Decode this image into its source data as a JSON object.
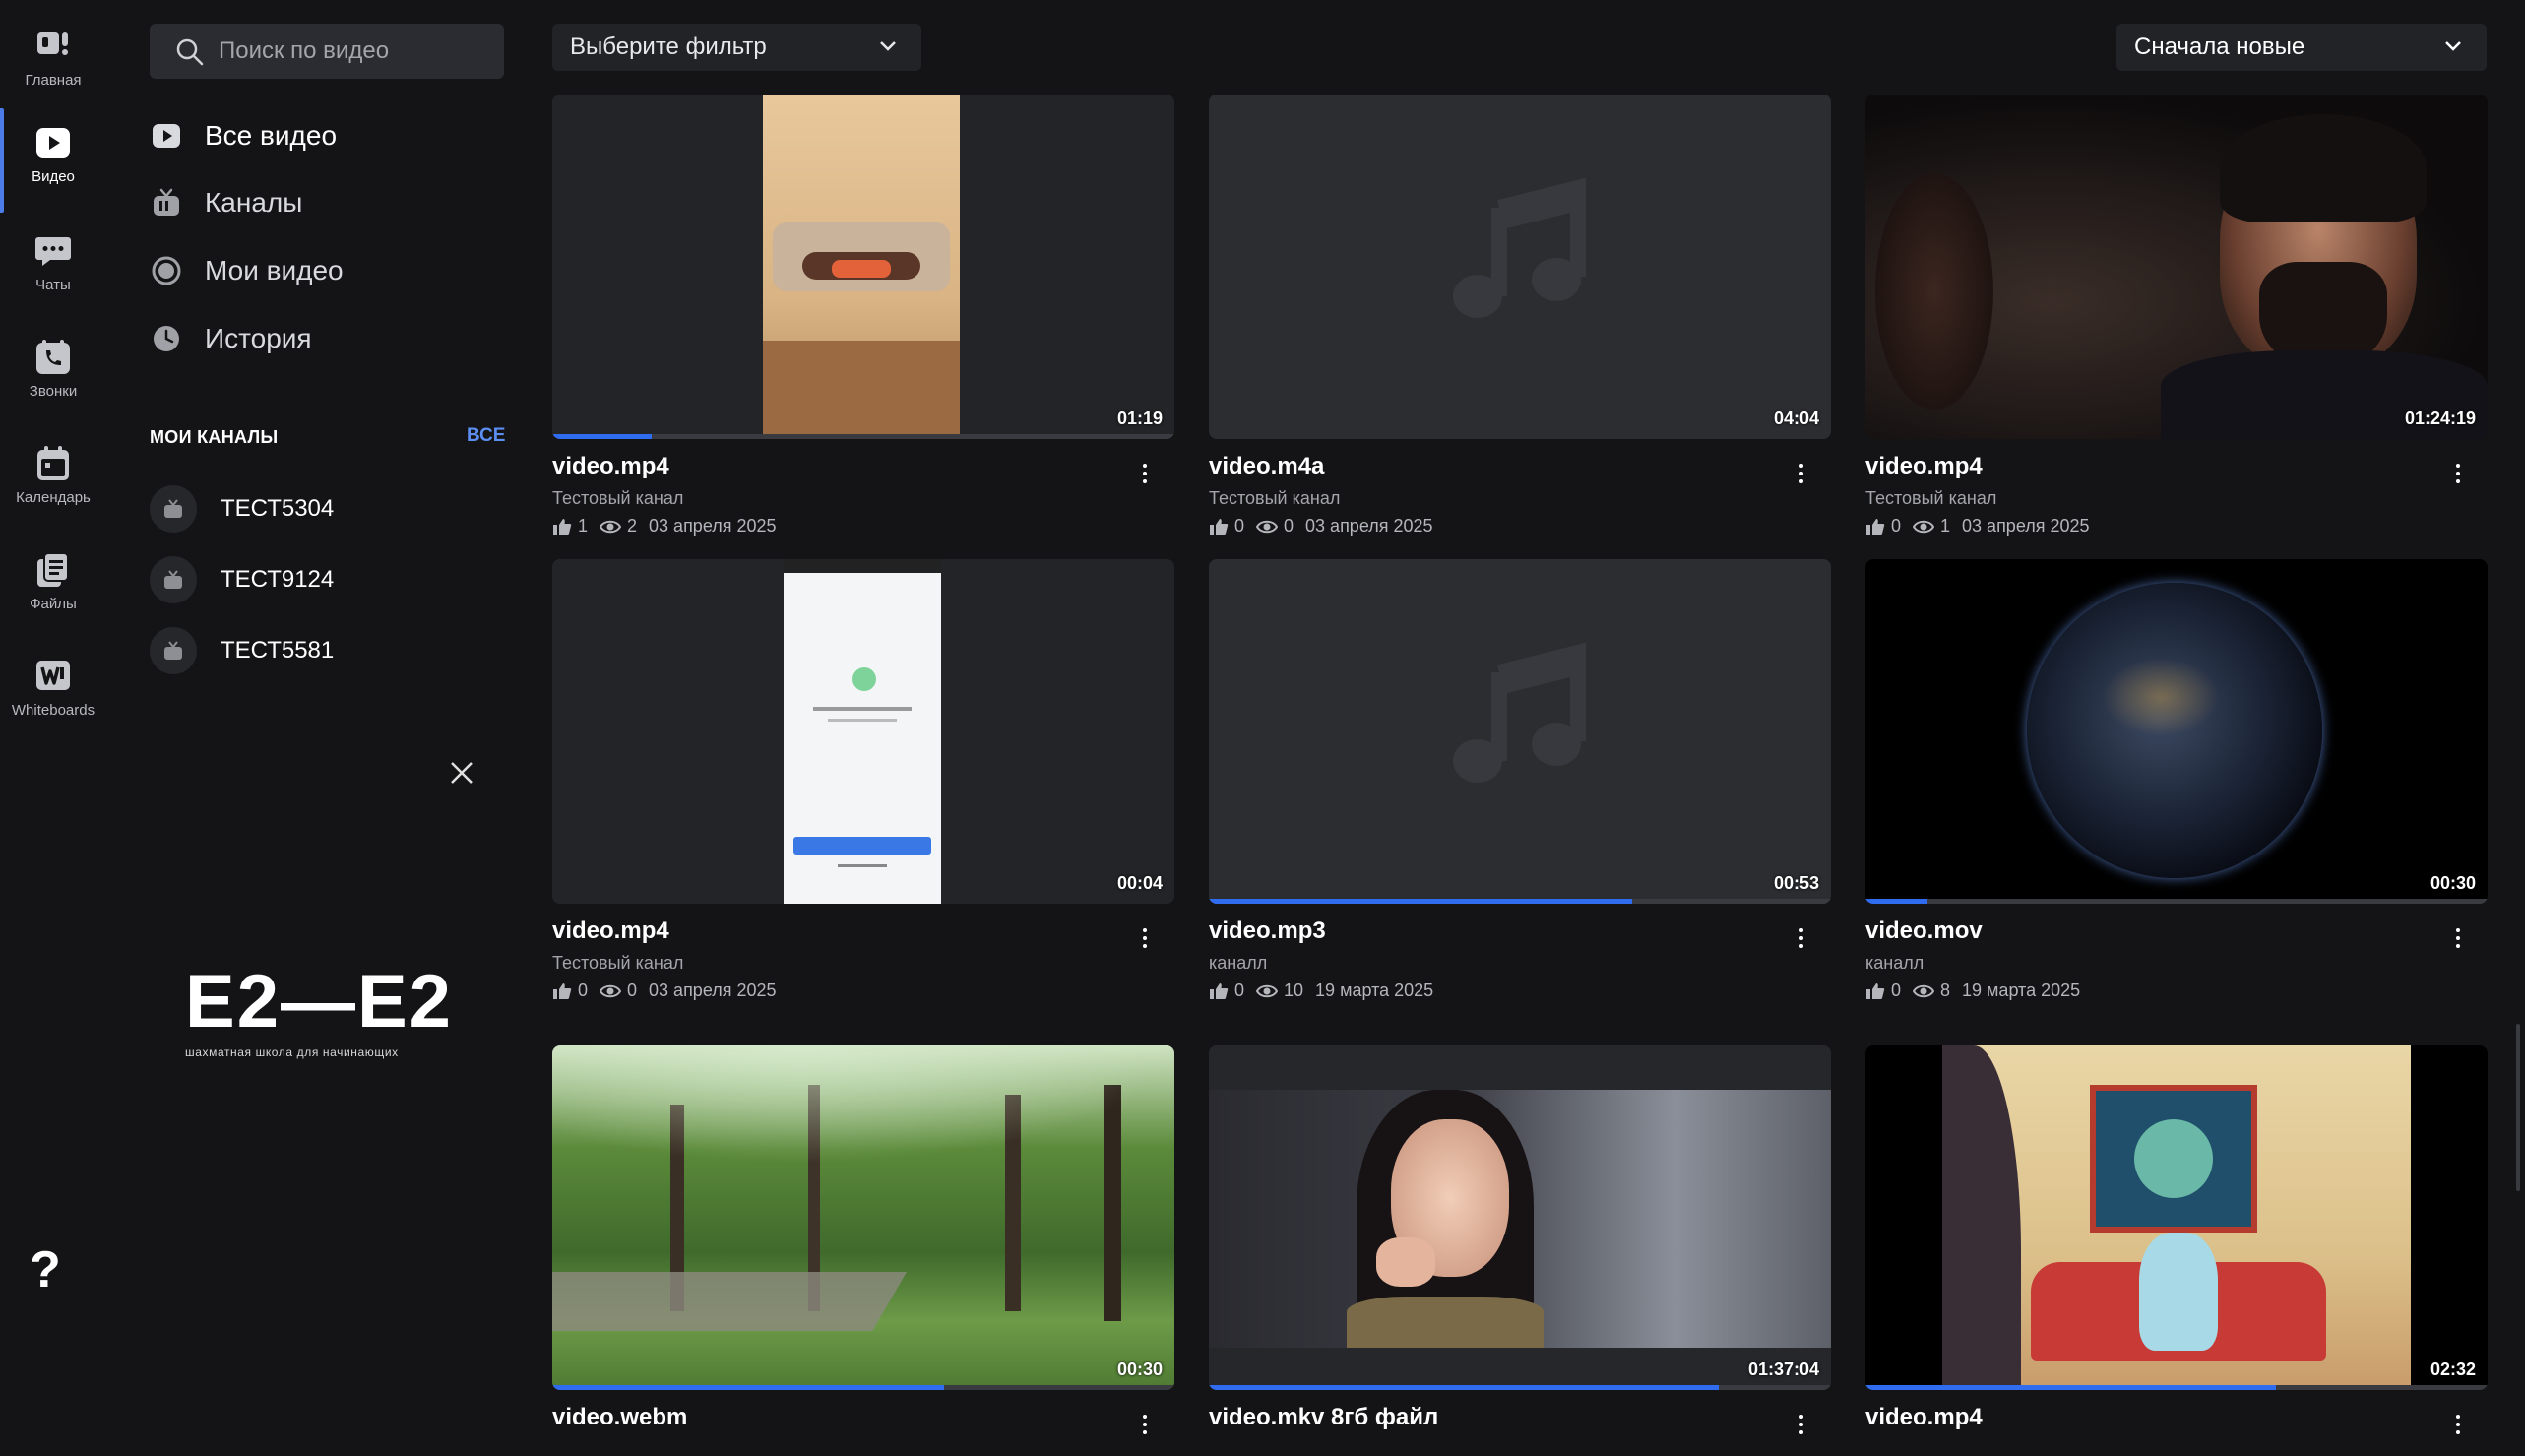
{
  "rail": [
    {
      "label": "Главная",
      "icon": "home-icon"
    },
    {
      "label": "Видео",
      "icon": "video-icon",
      "active": true
    },
    {
      "label": "Чаты",
      "icon": "chat-icon"
    },
    {
      "label": "Звонки",
      "icon": "phone-icon"
    },
    {
      "label": "Календарь",
      "icon": "calendar-icon"
    },
    {
      "label": "Файлы",
      "icon": "files-icon"
    },
    {
      "label": "Whiteboards",
      "icon": "whiteboard-icon"
    }
  ],
  "help": "?",
  "search": {
    "placeholder": "Поиск по видео"
  },
  "nav": [
    {
      "label": "Все видео",
      "icon": "play-icon"
    },
    {
      "label": "Каналы",
      "icon": "tv-icon"
    },
    {
      "label": "Мои видео",
      "icon": "my-video-icon"
    },
    {
      "label": "История",
      "icon": "clock-icon"
    }
  ],
  "channels": {
    "title": "МОИ КАНАЛЫ",
    "all": "ВСЕ",
    "items": [
      "ТЕСТ5304",
      "ТЕСТ9124",
      "ТЕСТ5581"
    ]
  },
  "logo": {
    "main": "E2—E2",
    "sub": "шахматная школа для начинающих"
  },
  "filter": {
    "label": "Выберите фильтр"
  },
  "sort": {
    "label": "Сначала новые"
  },
  "accent": "#2f6cf0",
  "videos": [
    {
      "title": "video.mp4",
      "channel": "Тестовый канал",
      "likes": "1",
      "views": "2",
      "date": "03 апреля 2025",
      "duration": "01:19",
      "progress": 0.16,
      "thumb": "phone-drawing"
    },
    {
      "title": "video.m4a",
      "channel": "Тестовый канал",
      "likes": "0",
      "views": "0",
      "date": "03 апреля 2025",
      "duration": "04:04",
      "progress": 0,
      "thumb": "audio"
    },
    {
      "title": "video.mp4",
      "channel": "Тестовый канал",
      "likes": "0",
      "views": "1",
      "date": "03 апреля 2025",
      "duration": "01:24:19",
      "progress": 0,
      "thumb": "portrait-man"
    },
    {
      "title": "video.mp4",
      "channel": "Тестовый канал",
      "likes": "0",
      "views": "0",
      "date": "03 апреля 2025",
      "duration": "00:04",
      "progress": 0,
      "thumb": "phone-screen"
    },
    {
      "title": "video.mp3",
      "channel": "каналл",
      "likes": "0",
      "views": "10",
      "date": "19 марта 2025",
      "duration": "00:53",
      "progress": 0.68,
      "thumb": "audio"
    },
    {
      "title": "video.mov",
      "channel": "каналл",
      "likes": "0",
      "views": "8",
      "date": "19 марта 2025",
      "duration": "00:30",
      "progress": 0.1,
      "thumb": "earth"
    },
    {
      "title": "video.webm",
      "channel": "",
      "likes": "",
      "views": "",
      "date": "",
      "duration": "00:30",
      "progress": 0.63,
      "thumb": "park"
    },
    {
      "title": "video.mkv 8гб файл",
      "channel": "",
      "likes": "",
      "views": "",
      "date": "",
      "duration": "01:37:04",
      "progress": 0.82,
      "thumb": "woman"
    },
    {
      "title": "video.mp4",
      "channel": "",
      "likes": "",
      "views": "",
      "date": "",
      "duration": "02:32",
      "progress": 0.66,
      "thumb": "anime"
    }
  ]
}
